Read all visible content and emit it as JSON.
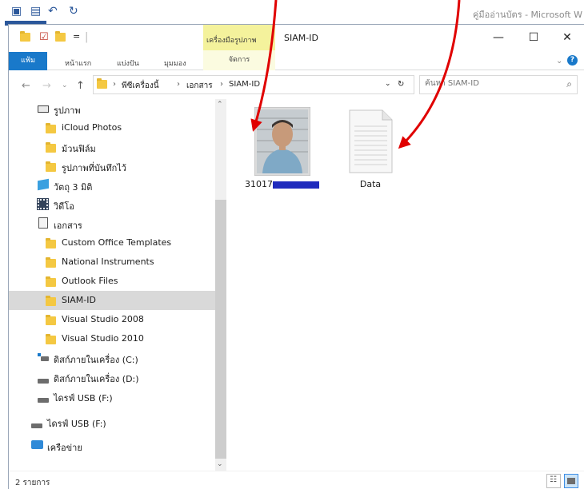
{
  "background_app": {
    "title": "คู่มืออ่านบัตร - Microsoft W"
  },
  "window": {
    "context_tab_label": "เครื่องมือรูปภาพ",
    "title": "SIAM-ID",
    "buttons": {
      "minimize": "—",
      "maximize": "☐",
      "close": "✕"
    }
  },
  "ribbon": {
    "tabs": [
      "แฟ้ม",
      "หน้าแรก",
      "แบ่งปัน",
      "มุมมอง"
    ],
    "context_tab": "จัดการ"
  },
  "address": {
    "crumbs": [
      "พีซีเครื่องนี้",
      "เอกสาร",
      "SIAM-ID"
    ],
    "separator": "›",
    "refresh": "↻"
  },
  "search": {
    "placeholder": "ค้นหา SIAM-ID"
  },
  "nav_pane": {
    "items": [
      {
        "label": "รูปภาพ",
        "icon": "pictures-icon"
      },
      {
        "label": "iCloud Photos",
        "icon": "folder-icon"
      },
      {
        "label": "ม้วนฟิล์ม",
        "icon": "folder-icon"
      },
      {
        "label": "รูปภาพที่บันทึกไว้",
        "icon": "folder-icon"
      },
      {
        "label": "วัตถุ 3 มิติ",
        "icon": "3d-objects-icon"
      },
      {
        "label": "วิดีโอ",
        "icon": "videos-icon"
      },
      {
        "label": "เอกสาร",
        "icon": "documents-icon"
      },
      {
        "label": "Custom Office Templates",
        "icon": "folder-icon"
      },
      {
        "label": "National Instruments",
        "icon": "folder-icon"
      },
      {
        "label": "Outlook Files",
        "icon": "folder-icon"
      },
      {
        "label": "SIAM-ID",
        "icon": "folder-icon",
        "selected": true
      },
      {
        "label": "Visual Studio 2008",
        "icon": "folder-icon"
      },
      {
        "label": "Visual Studio 2010",
        "icon": "folder-icon"
      },
      {
        "label": "ดิสก์ภายในเครื่อง (C:)",
        "icon": "system-drive-icon"
      },
      {
        "label": "ดิสก์ภายในเครื่อง (D:)",
        "icon": "drive-icon"
      },
      {
        "label": "ไดรฟ์ USB (F:)",
        "icon": "usb-drive-icon"
      },
      {
        "label": "ไดรฟ์ USB (F:)",
        "icon": "usb-drive-icon"
      },
      {
        "label": "เครือข่าย",
        "icon": "network-icon"
      }
    ]
  },
  "files": [
    {
      "name": "31017",
      "type": "image",
      "redacted": true
    },
    {
      "name": "Data",
      "type": "text-document"
    }
  ],
  "status": {
    "item_count": "2 รายการ"
  },
  "colors": {
    "accent": "#1979ca",
    "context_tab": "#f4f29c",
    "annotation_arrow": "#e00000",
    "redaction": "#1f2bbd"
  }
}
